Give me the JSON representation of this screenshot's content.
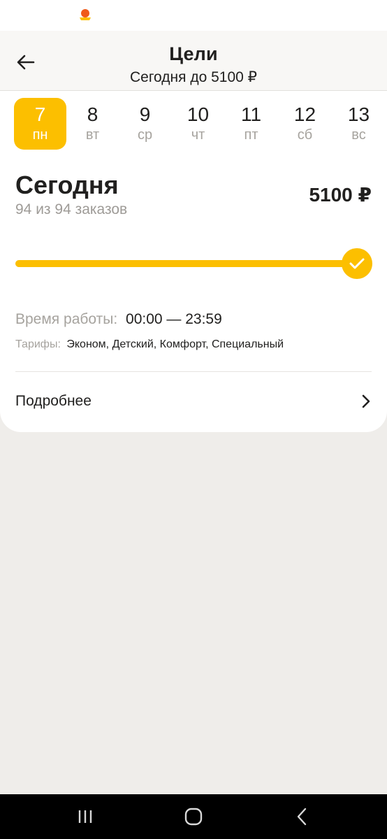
{
  "status_bar": {
    "icons": [
      "yandex-pro-logo-icon"
    ]
  },
  "header": {
    "title": "Цели",
    "subtitle": "Сегодня до 5100 ₽",
    "back_icon": "arrow-left-icon"
  },
  "days": [
    {
      "num": "7",
      "name": "пн",
      "selected": true
    },
    {
      "num": "8",
      "name": "вт",
      "selected": false
    },
    {
      "num": "9",
      "name": "ср",
      "selected": false
    },
    {
      "num": "10",
      "name": "чт",
      "selected": false
    },
    {
      "num": "11",
      "name": "пт",
      "selected": false
    },
    {
      "num": "12",
      "name": "сб",
      "selected": false
    },
    {
      "num": "13",
      "name": "вс",
      "selected": false
    }
  ],
  "goal": {
    "title": "Сегодня",
    "orders": "94 из 94 заказов",
    "amount": "5100 ₽",
    "progress": 1.0,
    "status_icon": "checkmark-icon"
  },
  "info": {
    "work_time_label": "Время работы:",
    "work_time_value": "00:00 — 23:59",
    "tariffs_label": "Тарифы:",
    "tariffs_value": "Эконом, Детский, Комфорт, Специальный"
  },
  "more": {
    "label": "Подробнее",
    "icon": "chevron-right-icon"
  },
  "colors": {
    "accent": "#fcbf00",
    "background": "#efedea",
    "card": "#ffffff",
    "muted_text": "#a6a39e"
  },
  "nav_bar": {
    "icons": [
      "recent-apps-icon",
      "home-icon",
      "back-icon"
    ]
  }
}
